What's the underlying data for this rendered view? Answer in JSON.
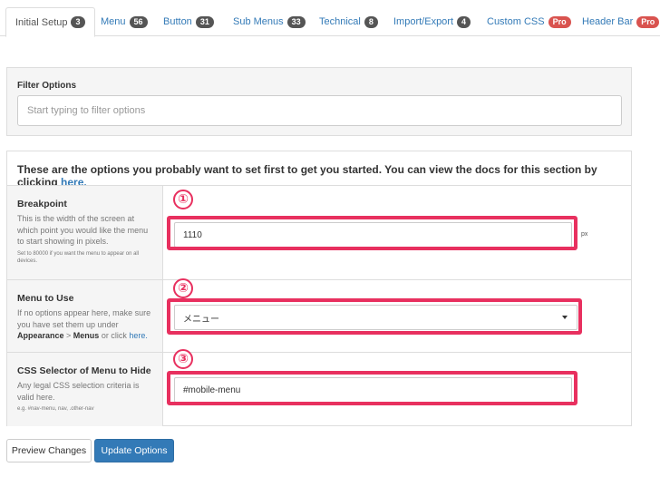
{
  "tabs": [
    {
      "label": "Initial Setup",
      "badge": "3"
    },
    {
      "label": "Menu",
      "badge": "56"
    },
    {
      "label": "Button",
      "badge": "31"
    },
    {
      "label": "Sub Menus",
      "badge": "33"
    },
    {
      "label": "Technical",
      "badge": "8"
    },
    {
      "label": "Import/Export",
      "badge": "4"
    },
    {
      "label": "Custom CSS",
      "badge": "Pro"
    },
    {
      "label": "Header Bar",
      "badge": "Pro"
    }
  ],
  "filter": {
    "title": "Filter Options",
    "placeholder": "Start typing to filter options"
  },
  "intro": {
    "text": "These are the options you probably want to set first to get you started. You can view the docs for this section by clicking ",
    "link": "here."
  },
  "rows": {
    "breakpoint": {
      "marker": "①",
      "title": "Breakpoint",
      "desc": "This is the width of the screen at which point you would like the menu to start showing in pixels.",
      "small": "Set to 80000 if you want the menu to appear on all devices.",
      "value": "1110",
      "unit": "px"
    },
    "menu": {
      "marker": "②",
      "title": "Menu to Use",
      "desc_a": "If no options appear here, make sure you have set them up under ",
      "desc_b": "Appearance",
      "desc_c": " > ",
      "desc_d": "Menus",
      "desc_e": " or click ",
      "desc_link": "here.",
      "value": "メニュー"
    },
    "css": {
      "marker": "③",
      "title": "CSS Selector of Menu to Hide",
      "desc": "Any legal CSS selection criteria is valid here.",
      "small": "e.g. #nav-menu, nav, .other-nav",
      "value": "#mobile-menu"
    }
  },
  "buttons": {
    "preview": "Preview Changes",
    "update": "Update Options"
  },
  "colors": {
    "highlight": "#e8305f",
    "primary": "#337ab7",
    "badge": "#555555",
    "pro_badge": "#d9534f"
  }
}
